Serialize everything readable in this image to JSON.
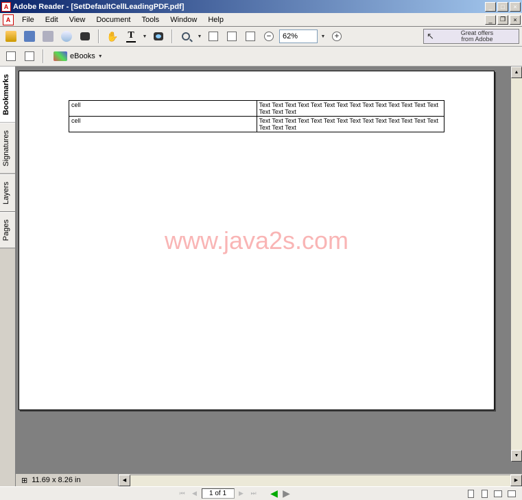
{
  "titlebar": {
    "app": "Adobe Reader",
    "doc": "[SetDefaultCellLeadingPDF.pdf]"
  },
  "menu": [
    "File",
    "Edit",
    "View",
    "Document",
    "Tools",
    "Window",
    "Help"
  ],
  "toolbar": {
    "zoom_value": "62%",
    "offer_line1": "Great offers",
    "offer_line2": "from Adobe",
    "ebooks_label": "eBooks"
  },
  "sidebar": [
    "Bookmarks",
    "Signatures",
    "Layers",
    "Pages"
  ],
  "sidebar_active": 0,
  "page_dimensions": "11.69 x 8.26 in",
  "page_nav": {
    "label": "1 of 1"
  },
  "watermark": "www.java2s.com",
  "pdf_table": {
    "rows": [
      {
        "c1": "cell",
        "c2": "Text Text Text Text Text Text Text Text Text Text Text Text Text Text Text Text Text"
      },
      {
        "c1": "cell",
        "c2": "Text Text Text Text Text Text Text Text Text Text Text Text Text Text Text Text Text"
      }
    ]
  }
}
